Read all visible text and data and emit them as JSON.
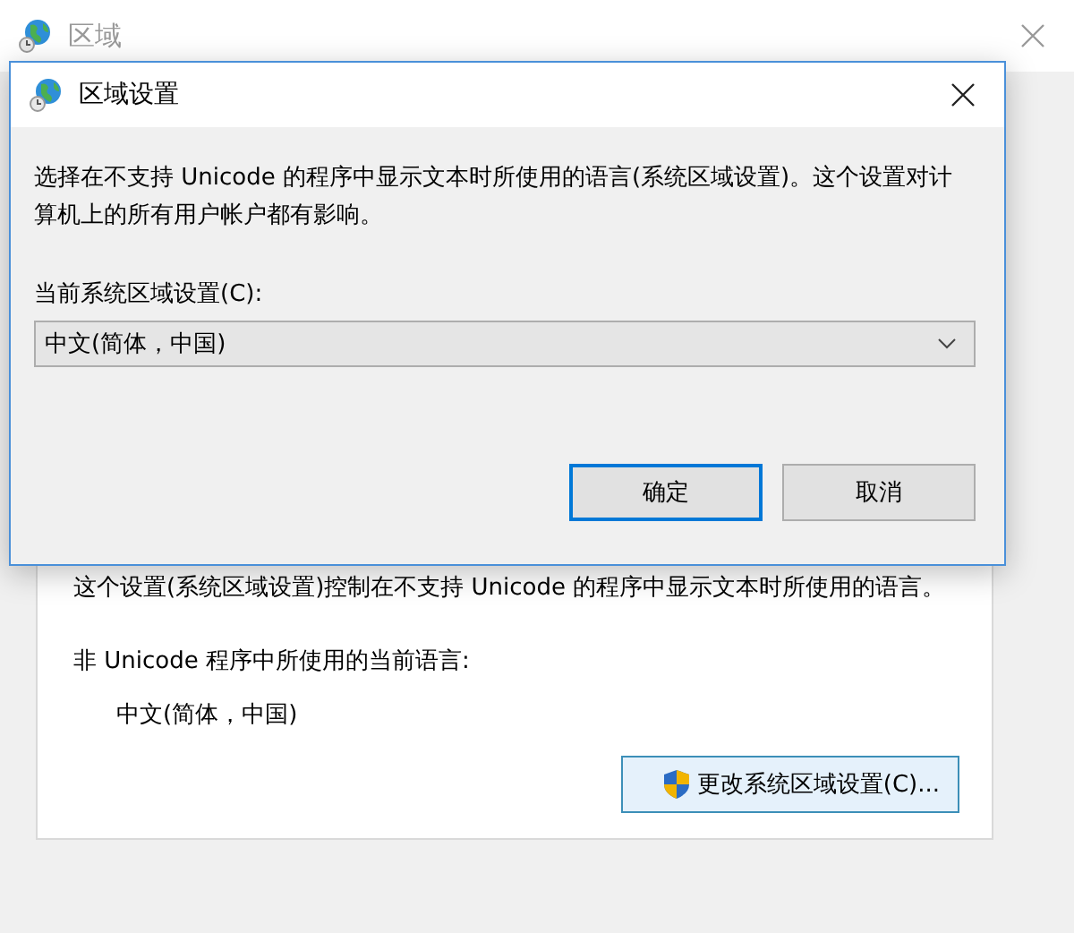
{
  "back_window": {
    "title": "区域",
    "panel_text": "这个设置(系统区域设置)控制在不支持 Unicode 的程序中显示文本时所使用的语言。",
    "current_language_label": "非 Unicode 程序中所使用的当前语言:",
    "current_language": "中文(简体，中国)",
    "change_button": "更改系统区域设置(C)..."
  },
  "dialog": {
    "title": "区域设置",
    "description": "选择在不支持 Unicode 的程序中显示文本时所使用的语言(系统区域设置)。这个设置对计算机上的所有用户帐户都有影响。",
    "locale_label": "当前系统区域设置(C):",
    "locale_value": "中文(简体，中国)",
    "buttons": [
      {
        "label": "确定",
        "kind": "default"
      },
      {
        "label": "取消",
        "kind": "normal"
      }
    ]
  }
}
